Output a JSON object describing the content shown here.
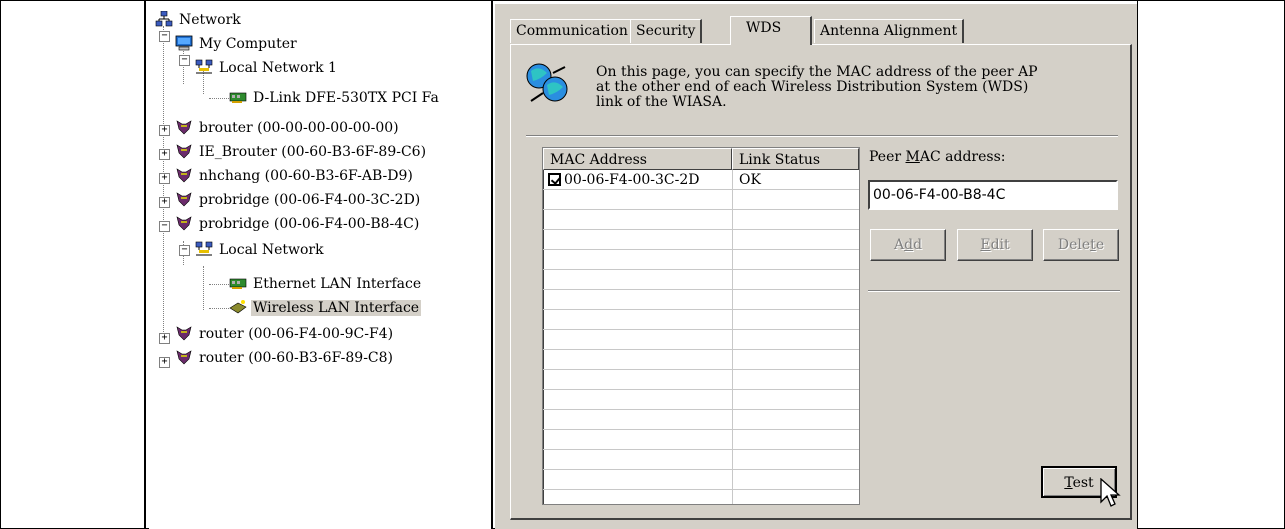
{
  "tree": {
    "items": [
      {
        "label": "Network",
        "icon": "network-icon"
      },
      {
        "label": "My Computer",
        "icon": "computer-icon"
      },
      {
        "label": "Local Network 1",
        "icon": "local-network-icon"
      },
      {
        "label": "D-Link DFE-530TX PCI Fa",
        "icon": "network-card-icon"
      },
      {
        "label": "brouter (00-00-00-00-00-00)",
        "icon": "device-icon"
      },
      {
        "label": "IE_Brouter (00-60-B3-6F-89-C6)",
        "icon": "device-icon"
      },
      {
        "label": "nhchang (00-60-B3-6F-AB-D9)",
        "icon": "device-icon"
      },
      {
        "label": "probridge (00-06-F4-00-3C-2D)",
        "icon": "device-icon"
      },
      {
        "label": "probridge (00-06-F4-00-B8-4C)",
        "icon": "device-icon"
      },
      {
        "label": "Local Network",
        "icon": "local-network-icon"
      },
      {
        "label": "Ethernet LAN Interface",
        "icon": "network-card-icon"
      },
      {
        "label": "Wireless LAN Interface",
        "icon": "wireless-card-icon"
      },
      {
        "label": "router (00-06-F4-00-9C-F4)",
        "icon": "device-icon"
      },
      {
        "label": "router (00-60-B3-6F-89-C8)",
        "icon": "device-icon"
      }
    ],
    "expand_plus": "+",
    "expand_minus": "−"
  },
  "tabs": {
    "communication": "Communication",
    "security": "Security",
    "wds": "WDS",
    "antenna": "Antenna Alignment"
  },
  "wds": {
    "info_text": "On this page, you can specify the MAC address of the peer AP at the other end of each Wireless Distribution System (WDS) link of the WIASA.",
    "columns": {
      "mac": "MAC Address",
      "status": "Link Status"
    },
    "rows": [
      {
        "mac": "00-06-F4-00-3C-2D",
        "status": "OK",
        "checked": true
      }
    ],
    "peer_label_pre": "Peer ",
    "peer_label_access": "M",
    "peer_label_post": "AC address:",
    "peer_mac_value": "00-06-F4-00-B8-4C",
    "buttons": {
      "add_pre": "A",
      "add_access": "d",
      "add_post": "d",
      "edit_access": "E",
      "edit_post": "dit",
      "delete_pre": "Dele",
      "delete_access": "t",
      "delete_post": "e",
      "test_access": "T",
      "test_post": "est"
    }
  },
  "colors": {
    "face": "#d4d0c8",
    "selection": "#d4d0c8",
    "disabled_text": "#808080"
  }
}
